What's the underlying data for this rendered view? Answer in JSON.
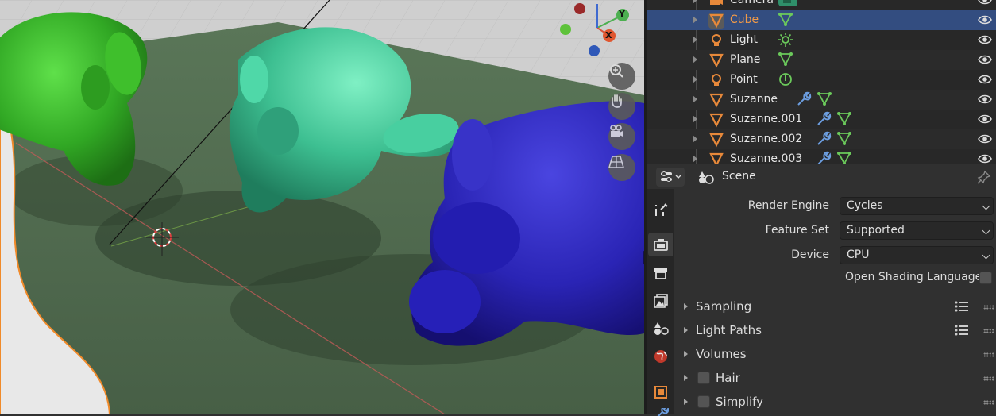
{
  "outliner": {
    "items": [
      {
        "name": "Camera",
        "type": "camera",
        "mods": [
          "camera-data"
        ],
        "selected": false
      },
      {
        "name": "Cube",
        "type": "mesh",
        "mods": [
          "mesh-data"
        ],
        "selected": true
      },
      {
        "name": "Light",
        "type": "light",
        "mods": [
          "light-data"
        ],
        "selected": false
      },
      {
        "name": "Plane",
        "type": "mesh",
        "mods": [
          "mesh-data"
        ],
        "selected": false
      },
      {
        "name": "Point",
        "type": "light",
        "mods": [
          "point-light-data"
        ],
        "selected": false
      },
      {
        "name": "Suzanne",
        "type": "mesh",
        "mods": [
          "wrench-modifier",
          "mesh-data"
        ],
        "selected": false
      },
      {
        "name": "Suzanne.001",
        "type": "mesh",
        "mods": [
          "wrench-modifier",
          "mesh-data"
        ],
        "selected": false
      },
      {
        "name": "Suzanne.002",
        "type": "mesh",
        "mods": [
          "wrench-modifier",
          "mesh-data"
        ],
        "selected": false
      },
      {
        "name": "Suzanne.003",
        "type": "mesh",
        "mods": [
          "wrench-modifier",
          "mesh-data"
        ],
        "selected": false
      }
    ]
  },
  "properties": {
    "context": "Scene",
    "render_engine": {
      "label": "Render Engine",
      "value": "Cycles"
    },
    "feature_set": {
      "label": "Feature Set",
      "value": "Supported"
    },
    "device": {
      "label": "Device",
      "value": "CPU"
    },
    "osl": {
      "label": "Open Shading Language",
      "checked": false
    },
    "panels": [
      {
        "title": "Sampling",
        "has_checkbox": false,
        "has_list": true
      },
      {
        "title": "Light Paths",
        "has_checkbox": false,
        "has_list": true
      },
      {
        "title": "Volumes",
        "has_checkbox": false,
        "has_list": false
      },
      {
        "title": "Hair",
        "has_checkbox": true,
        "has_list": false
      },
      {
        "title": "Simplify",
        "has_checkbox": true,
        "has_list": false
      }
    ],
    "tabs": [
      "tool-icon",
      "render-icon",
      "output-icon",
      "view-layer-icon",
      "scene-icon",
      "world-icon",
      "object-icon"
    ]
  },
  "gizmo": {
    "y_label": "Y",
    "x_label": "X"
  },
  "colors": {
    "selection": "#334d80",
    "selected_name": "#f19a47",
    "mesh_icon": "#e8893a",
    "data_icon": "#6bc95b",
    "modifier_icon": "#6c9ee0",
    "monkey_green": "#38b52c",
    "monkey_teal": "#3fc496",
    "monkey_blue": "#2a25b8"
  }
}
